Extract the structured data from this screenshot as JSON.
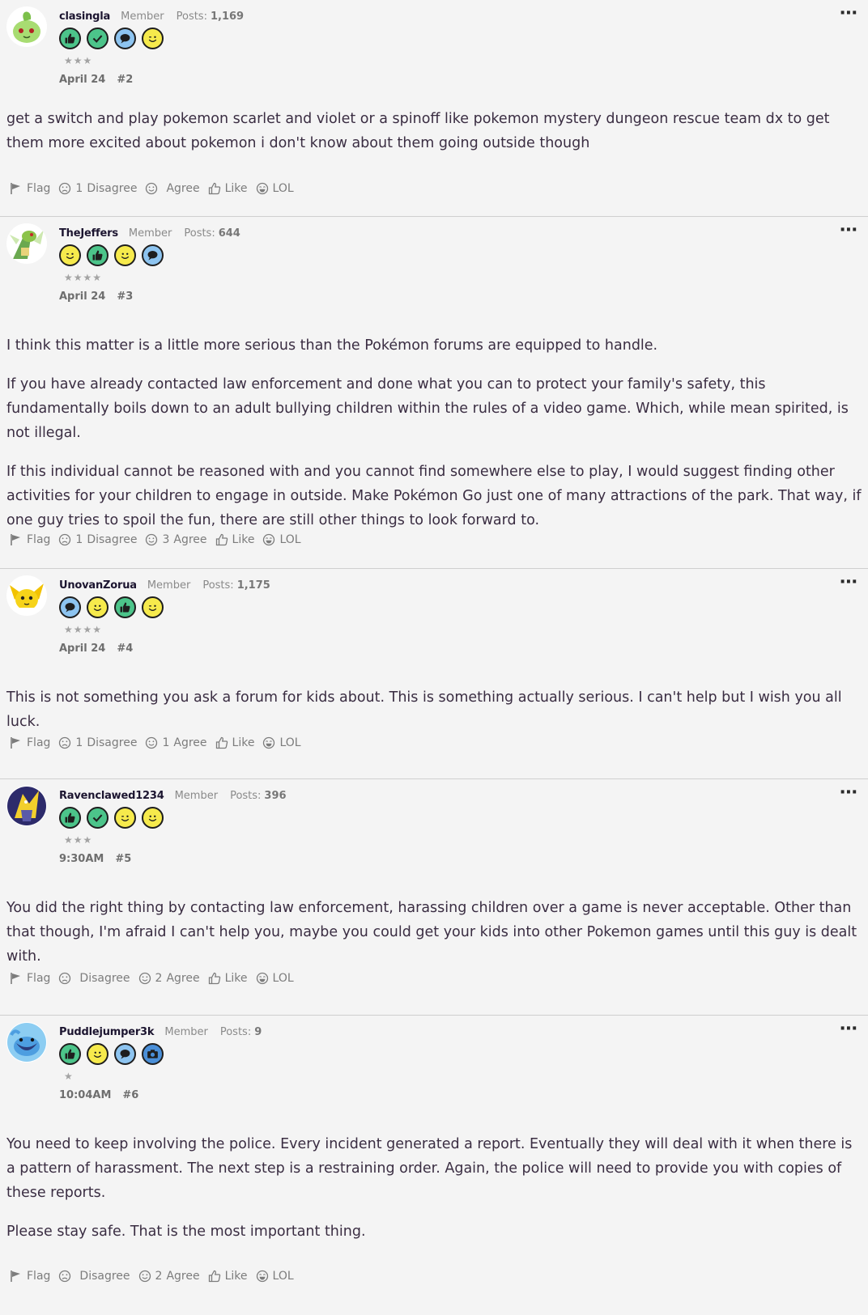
{
  "posts": [
    {
      "username": "clasingla",
      "role": "Member",
      "posts_label": "Posts:",
      "posts_count": "1,169",
      "badges": [
        "thumbs-up",
        "check",
        "speech",
        "wink"
      ],
      "stars": "★★★",
      "date": "April 24",
      "number": "#2",
      "paragraphs": [
        "get a switch and play pokemon scarlet and violet or a spinoff like pokemon mystery dungeon rescue team dx to get them more excited about pokemon i don't know about them going outside though"
      ],
      "actions": {
        "flag": "Flag",
        "disagree": "Disagree",
        "disagree_count": "1",
        "agree": "Agree",
        "agree_count": "",
        "like": "Like",
        "lol": "LOL"
      }
    },
    {
      "username": "TheJeffers",
      "role": "Member",
      "posts_label": "Posts:",
      "posts_count": "644",
      "badges": [
        "wink",
        "thumbs-up",
        "smile",
        "speech"
      ],
      "stars": "★★★★",
      "date": "April 24",
      "number": "#3",
      "paragraphs": [
        "I think this matter is a little more serious than the Pokémon forums are equipped to handle.",
        "If you have already contacted law enforcement and done what you can to protect your family's safety, this fundamentally boils down to an adult bullying children within the rules of a video game. Which, while mean spirited, is not illegal.",
        "If this individual cannot be reasoned with and you cannot find somewhere else to play, I would suggest finding other activities for your children to engage in outside. Make Pokémon Go just one of many attractions of the park. That way, if one guy tries to spoil the fun, there are still other things to look forward to."
      ],
      "actions": {
        "flag": "Flag",
        "disagree": "Disagree",
        "disagree_count": "1",
        "agree": "Agree",
        "agree_count": "3",
        "like": "Like",
        "lol": "LOL"
      }
    },
    {
      "username": "UnovanZorua",
      "role": "Member",
      "posts_label": "Posts:",
      "posts_count": "1,175",
      "badges": [
        "speech",
        "smile",
        "thumbs-up",
        "wink"
      ],
      "stars": "★★★★",
      "date": "April 24",
      "number": "#4",
      "paragraphs": [
        "This is not something you ask a forum for kids about. This is something actually serious. I can't help but I wish you all luck."
      ],
      "actions": {
        "flag": "Flag",
        "disagree": "Disagree",
        "disagree_count": "1",
        "agree": "Agree",
        "agree_count": "1",
        "like": "Like",
        "lol": "LOL"
      }
    },
    {
      "username": "Ravenclawed1234",
      "role": "Member",
      "posts_label": "Posts:",
      "posts_count": "396",
      "badges": [
        "thumbs-up",
        "check",
        "wink",
        "smile"
      ],
      "stars": "★★★",
      "date": "9:30AM",
      "number": "#5",
      "paragraphs": [
        "You did the right thing by contacting law enforcement, harassing children over a game is never acceptable. Other than that though, I'm afraid I can't help you, maybe you could get your kids into other Pokemon games until this guy is dealt with."
      ],
      "actions": {
        "flag": "Flag",
        "disagree": "Disagree",
        "disagree_count": "",
        "agree": "Agree",
        "agree_count": "2",
        "like": "Like",
        "lol": "LOL"
      }
    },
    {
      "username": "Puddlejumper3k",
      "role": "Member",
      "posts_label": "Posts:",
      "posts_count": "9",
      "badges": [
        "thumbs-up",
        "smile",
        "speech",
        "camera"
      ],
      "stars": "★",
      "date": "10:04AM",
      "number": "#6",
      "paragraphs": [
        "You need to keep involving the police. Every incident generated a report. Eventually they will deal with it when there is a pattern of harassment. The next step is a restraining order. Again, the police will need to provide you with copies of these reports.",
        "Please stay safe. That is the most important thing."
      ],
      "actions": {
        "flag": "Flag",
        "disagree": "Disagree",
        "disagree_count": "",
        "agree": "Agree",
        "agree_count": "2",
        "like": "Like",
        "lol": "LOL"
      }
    }
  ]
}
